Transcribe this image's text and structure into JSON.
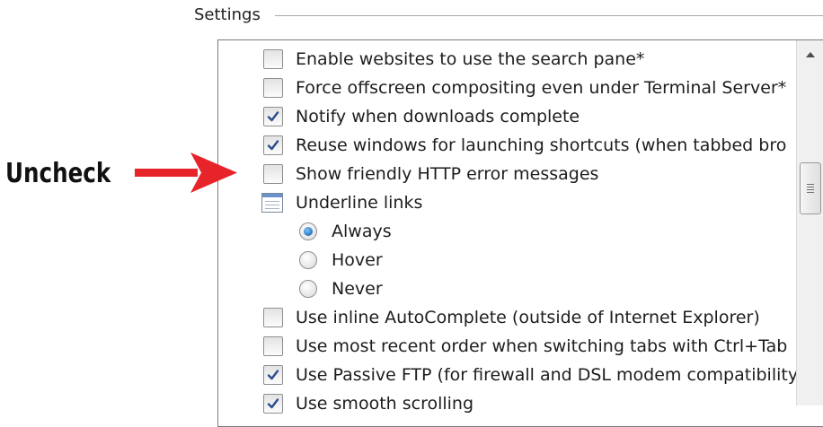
{
  "group": {
    "label": "Settings"
  },
  "items": [
    {
      "type": "checkbox",
      "checked": false,
      "label": "Enable websites to use the search pane*"
    },
    {
      "type": "checkbox",
      "checked": false,
      "label": "Force offscreen compositing even under Terminal Server*"
    },
    {
      "type": "checkbox",
      "checked": true,
      "label": "Notify when downloads complete"
    },
    {
      "type": "checkbox",
      "checked": true,
      "label": "Reuse windows for launching shortcuts (when tabbed bro"
    },
    {
      "type": "checkbox",
      "checked": false,
      "label": "Show friendly HTTP error messages"
    },
    {
      "type": "group",
      "label": "Underline links"
    },
    {
      "type": "radio",
      "selected": true,
      "label": "Always"
    },
    {
      "type": "radio",
      "selected": false,
      "label": "Hover"
    },
    {
      "type": "radio",
      "selected": false,
      "label": "Never"
    },
    {
      "type": "checkbox",
      "checked": false,
      "label": "Use inline AutoComplete (outside of Internet Explorer)"
    },
    {
      "type": "checkbox",
      "checked": false,
      "label": "Use most recent order when switching tabs with Ctrl+Tab"
    },
    {
      "type": "checkbox",
      "checked": true,
      "label": "Use Passive FTP (for firewall and DSL modem compatibility"
    },
    {
      "type": "checkbox",
      "checked": true,
      "label": "Use smooth scrolling"
    }
  ],
  "annotation": {
    "text": "Uncheck",
    "arrow_color": "#e8242b"
  },
  "icons": {
    "check": "check-icon",
    "scroll_up": "scroll-up-arrow-icon",
    "scroll_grip": "scroll-grip-icon",
    "group": "settings-group-icon",
    "arrow": "red-arrow-icon"
  }
}
